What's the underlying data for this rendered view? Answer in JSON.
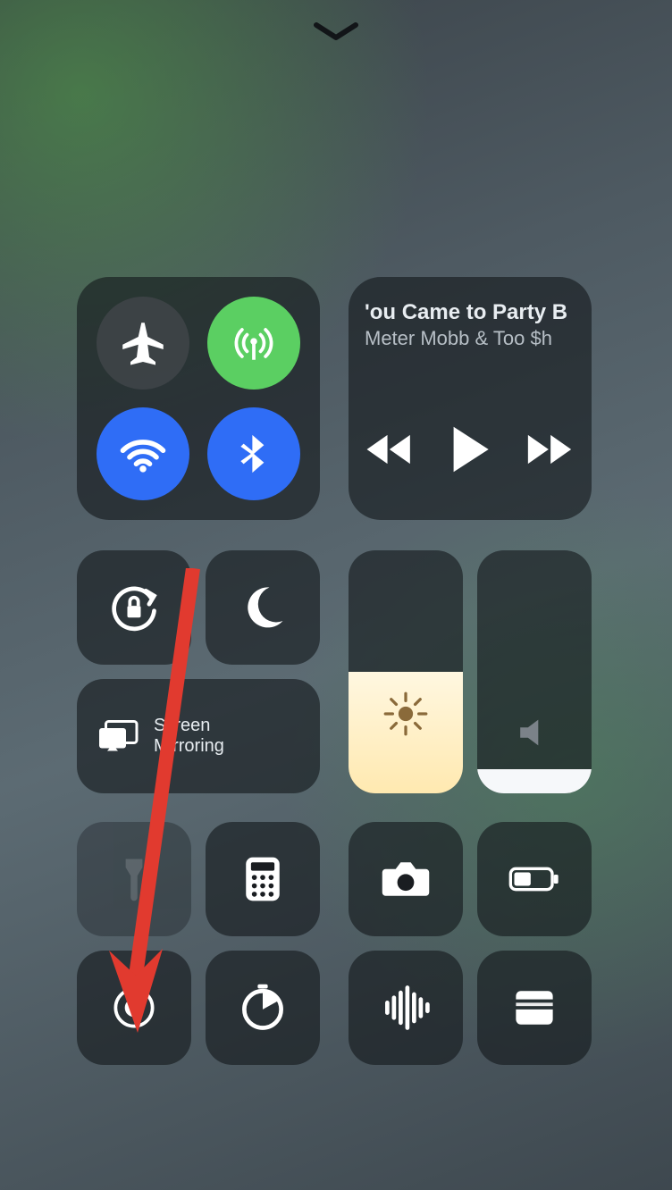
{
  "dismiss_hint": "chevron-down",
  "connectivity": {
    "airplane": {
      "icon": "airplane-icon",
      "active": false
    },
    "cellular": {
      "icon": "cellular-icon",
      "active": true,
      "color": "#5bcf62"
    },
    "wifi": {
      "icon": "wifi-icon",
      "active": true,
      "color": "#2f6df6"
    },
    "bluetooth": {
      "icon": "bluetooth-icon",
      "active": true,
      "color": "#2f6df6"
    }
  },
  "media": {
    "track_title": "'ou Came to Party B",
    "track_artist": "Meter Mobb & Too $h",
    "controls": {
      "prev": "rewind-icon",
      "play": "play-icon",
      "next": "fastforward-icon"
    },
    "state": "paused"
  },
  "row_tiles": {
    "orientation_lock": {
      "icon": "rotation-lock-icon"
    },
    "do_not_disturb": {
      "icon": "moon-icon"
    }
  },
  "screen_mirroring": {
    "icon": "screen-mirroring-icon",
    "label_line1": "Screen",
    "label_line2": "Mirroring"
  },
  "sliders": {
    "brightness": {
      "icon": "sun-icon",
      "level_percent": 50
    },
    "volume": {
      "icon": "speaker-icon",
      "level_percent": 10
    }
  },
  "grid_row1": {
    "flashlight": {
      "icon": "flashlight-icon",
      "enabled": false
    },
    "calculator": {
      "icon": "calculator-icon"
    },
    "camera": {
      "icon": "camera-icon"
    },
    "low_power": {
      "icon": "battery-icon"
    }
  },
  "grid_row2": {
    "screen_record": {
      "icon": "record-icon"
    },
    "timer": {
      "icon": "timer-icon"
    },
    "hearing": {
      "icon": "waveform-icon"
    },
    "wallet": {
      "icon": "wallet-icon"
    }
  },
  "annotation": {
    "type": "arrow",
    "color": "#e13a2f",
    "points_to": "screen_record"
  }
}
